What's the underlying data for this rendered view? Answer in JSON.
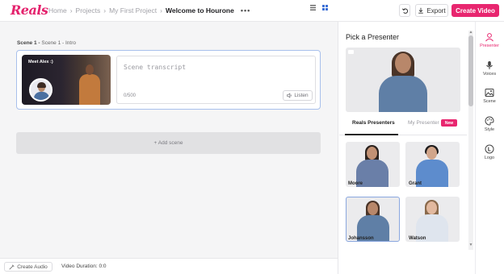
{
  "header": {
    "logo": "Reals",
    "breadcrumb": [
      "Home",
      "Projects",
      "My First Project"
    ],
    "current": "Welcome to Hourone",
    "more": "•••",
    "export_label": "Export",
    "create_label": "Create Video"
  },
  "scene": {
    "title_prefix": "Scene 1 -",
    "title_rest": "Scene 1 - Intro",
    "thumb_label": "Meet Alex :)",
    "transcript_placeholder": "Scene transcript",
    "char_count": "0/500",
    "listen_label": "Listen",
    "add_scene_label": "+ Add scene"
  },
  "footer": {
    "create_audio_label": "Create Audio",
    "duration": "Video Duration: 0:0"
  },
  "panel": {
    "title_prefix": "Pick a",
    "title_main": "Presenter",
    "tab_reals": "Reals Presenters",
    "tab_my": "My Presenter",
    "new_badge": "New",
    "presenters": [
      {
        "name": "Moore"
      },
      {
        "name": "Grant"
      },
      {
        "name": "Johansson"
      },
      {
        "name": "Watson"
      }
    ]
  },
  "rail": {
    "items": [
      {
        "label": "Presenter",
        "icon": "person-icon"
      },
      {
        "label": "Voices",
        "icon": "microphone-icon"
      },
      {
        "label": "Scene",
        "icon": "image-icon"
      },
      {
        "label": "Style",
        "icon": "palette-icon"
      },
      {
        "label": "Logo",
        "icon": "logo-l-icon"
      }
    ]
  },
  "colors": {
    "brand": "#e8266f",
    "selection": "#a8c0ec"
  }
}
